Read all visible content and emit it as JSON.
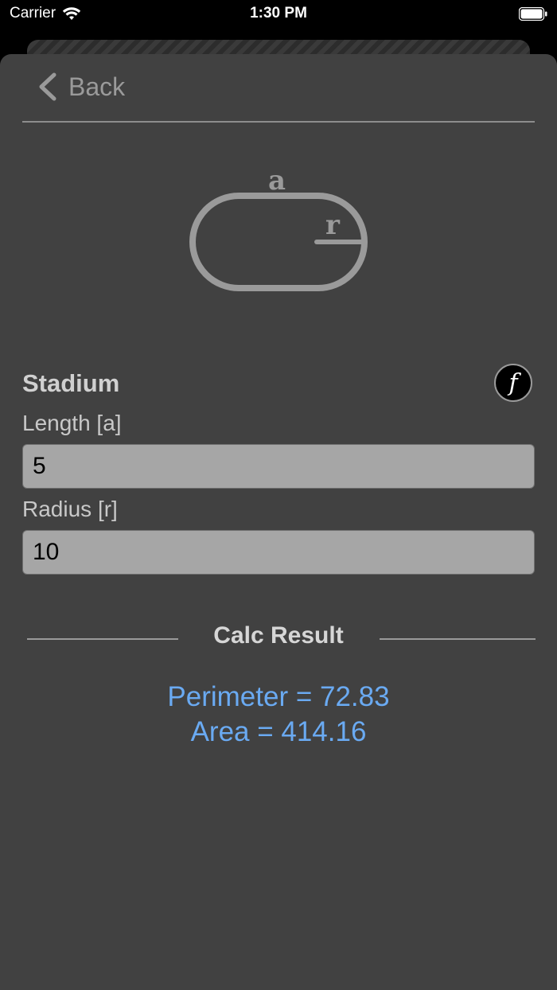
{
  "status_bar": {
    "carrier": "Carrier",
    "time": "1:30 PM",
    "wifi_icon": "wifi-icon",
    "battery_icon": "battery-icon"
  },
  "nav": {
    "back_label": "Back",
    "back_icon": "chevron-left-icon"
  },
  "diagram": {
    "icon": "stadium-shape-icon",
    "length_symbol": "a",
    "radius_symbol": "r"
  },
  "shape": {
    "title": "Stadium",
    "formula_symbol": "f",
    "formula_icon": "formula-icon"
  },
  "fields": {
    "length": {
      "label": "Length [a]",
      "value": "5"
    },
    "radius": {
      "label": "Radius [r]",
      "value": "10"
    }
  },
  "results": {
    "heading": "Calc Result",
    "perimeter": "Perimeter = 72.83",
    "area": "Area = 414.16"
  },
  "colors": {
    "background": "#414141",
    "result_text": "#6aaaf2",
    "input_background": "#a6a6a6"
  }
}
